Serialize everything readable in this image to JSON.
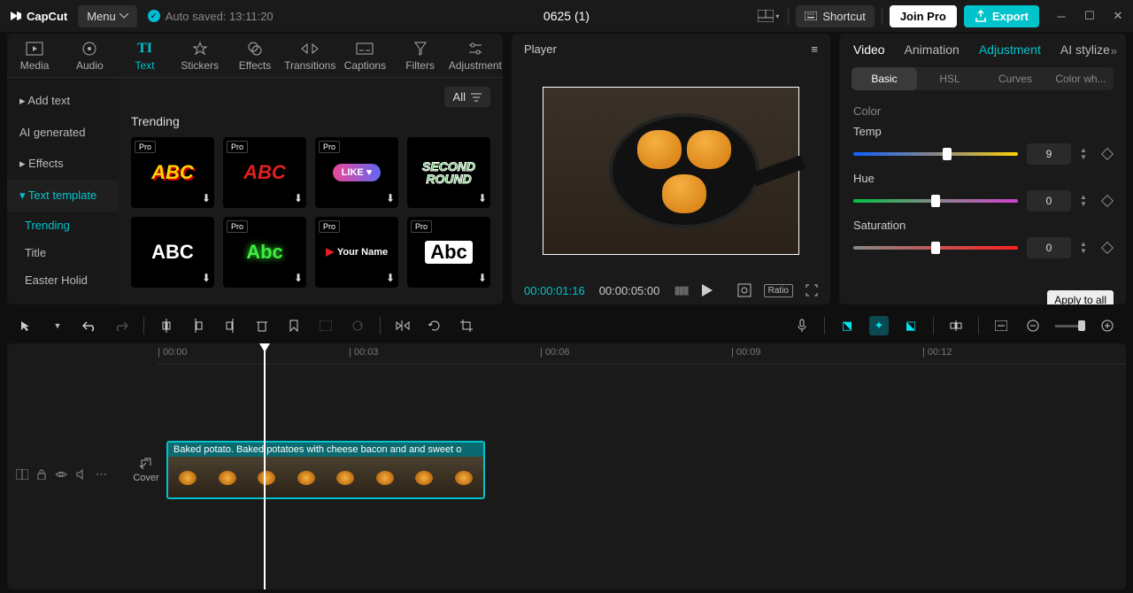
{
  "titlebar": {
    "app_name": "CapCut",
    "menu_label": "Menu",
    "autosave": "Auto saved: 13:11:20",
    "project_title": "0625 (1)",
    "shortcut": "Shortcut",
    "join_pro": "Join Pro",
    "export": "Export"
  },
  "media_tabs": [
    "Media",
    "Audio",
    "Text",
    "Stickers",
    "Effects",
    "Transitions",
    "Captions",
    "Filters",
    "Adjustment"
  ],
  "media_tab_active": "Text",
  "left_sidebar": {
    "items": [
      "Add text",
      "AI generated",
      "Effects",
      "Text template"
    ],
    "active": "Text template",
    "sub": [
      "Trending",
      "Title",
      "Easter Holid"
    ],
    "sub_active": "Trending"
  },
  "content": {
    "all_label": "All",
    "section": "Trending",
    "thumbs": [
      {
        "text": "ABC",
        "cls": "t-abc1",
        "pro": true
      },
      {
        "text": "ABC",
        "cls": "t-abc2",
        "pro": true
      },
      {
        "text": "LIKE ♥",
        "cls": "t-like",
        "pro": true
      },
      {
        "text": "SECOND\nROUND",
        "cls": "t-second",
        "pro": false
      },
      {
        "text": "ABC",
        "cls": "t-abc3",
        "pro": false
      },
      {
        "text": "Abc",
        "cls": "t-abc4",
        "pro": true
      },
      {
        "text": "Your Name",
        "cls": "t-yourname",
        "pro": true
      },
      {
        "text": "Abc",
        "cls": "t-abc5",
        "pro": true
      }
    ]
  },
  "player": {
    "header": "Player",
    "current_tc": "00:00:01:16",
    "duration": "00:00:05:00",
    "ratio": "Ratio"
  },
  "right": {
    "tabs": [
      "Video",
      "Animation",
      "Adjustment",
      "AI stylize"
    ],
    "active": "Adjustment",
    "subtabs": [
      "Basic",
      "HSL",
      "Curves",
      "Color wh..."
    ],
    "sub_active": "Basic",
    "section": "Color",
    "params": [
      {
        "name": "Temp",
        "value": "9",
        "pos": 57,
        "grad": "linear-gradient(90deg,#1060ff,#888 50%,#ffd000)"
      },
      {
        "name": "Hue",
        "value": "0",
        "pos": 50,
        "grad": "linear-gradient(90deg,#00c040,#888 50%,#d040d0)"
      },
      {
        "name": "Saturation",
        "value": "0",
        "pos": 50,
        "grad": "linear-gradient(90deg,#888,#ff2020)"
      }
    ],
    "tooltip": "Apply to all"
  },
  "timeline": {
    "marks": [
      "00:00",
      "00:03",
      "00:06",
      "00:09",
      "00:12"
    ],
    "clip_caption": "Baked potato. Baked potatoes with cheese  bacon and and sweet o",
    "cover": "Cover"
  }
}
